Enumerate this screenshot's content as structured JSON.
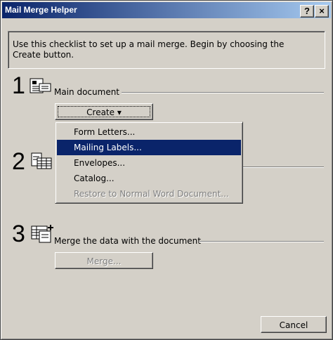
{
  "window": {
    "title": "Mail Merge Helper",
    "help_button": "?",
    "close_button": "×"
  },
  "intro": {
    "text": "Use this checklist to set up a mail merge. Begin by choosing the Create button."
  },
  "steps": [
    {
      "number": "1",
      "label": "Main document",
      "icon": "document-icon",
      "button": "Create ▾"
    },
    {
      "number": "2",
      "label": "",
      "icon": "data-source-icon"
    },
    {
      "number": "3",
      "label": "Merge the data with the document",
      "icon": "merge-icon",
      "button": "Merge..."
    }
  ],
  "create_menu": {
    "items": [
      {
        "label": "Form Letters...",
        "state": "normal"
      },
      {
        "label": "Mailing Labels...",
        "state": "selected"
      },
      {
        "label": "Envelopes...",
        "state": "normal"
      },
      {
        "label": "Catalog...",
        "state": "normal"
      },
      {
        "label": "Restore to Normal Word Document...",
        "state": "disabled"
      }
    ]
  },
  "footer": {
    "cancel_label": "Cancel"
  },
  "colors": {
    "face": "#d4d0c8",
    "title_start": "#0a246a",
    "title_end": "#a6caf0",
    "selection": "#0a246a"
  }
}
